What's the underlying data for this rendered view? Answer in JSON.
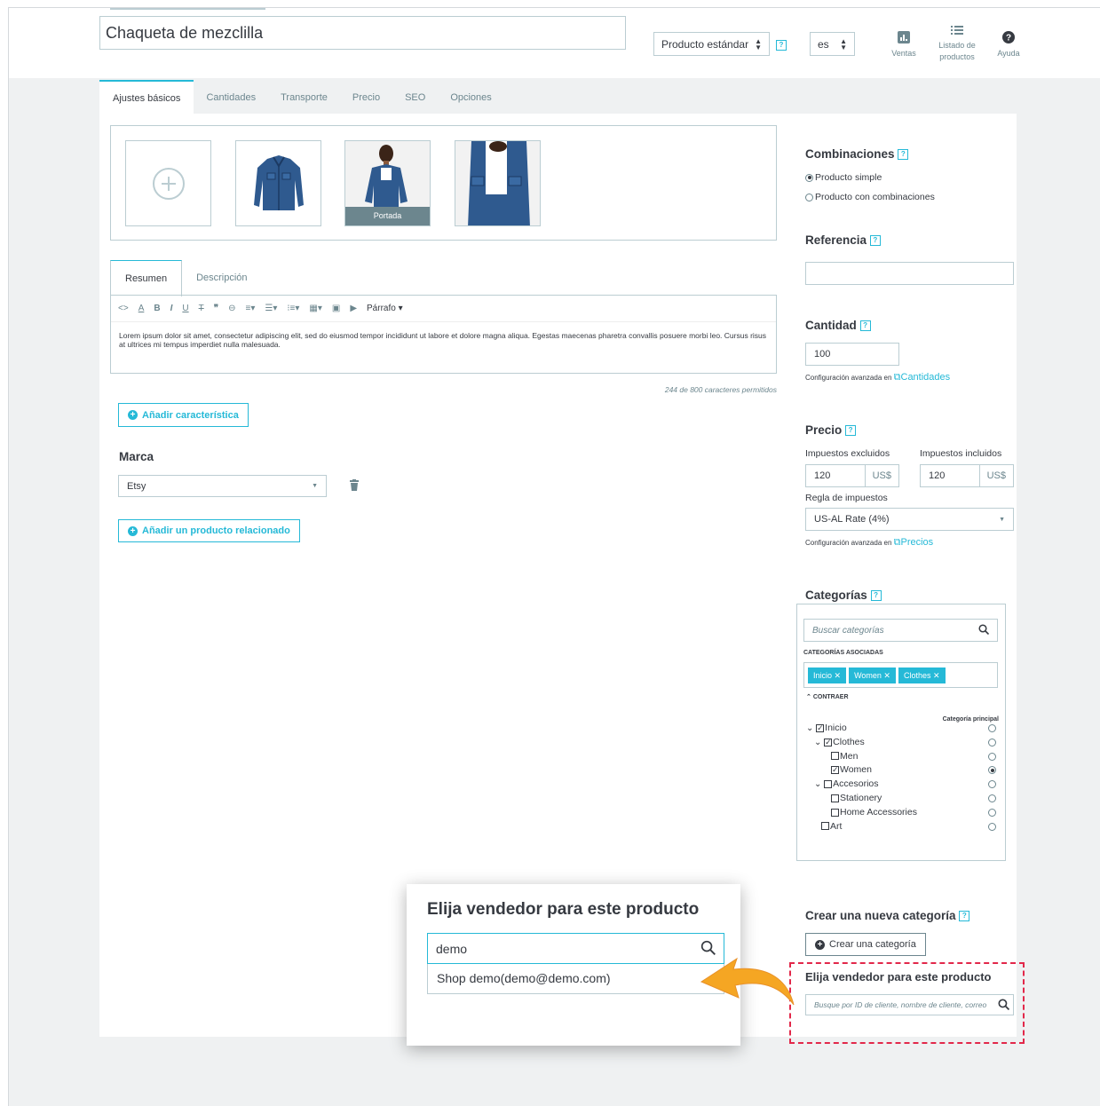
{
  "header": {
    "product_name": "Chaqueta de mezclilla",
    "product_type": "Producto estándar",
    "language": "es",
    "help_mark": "?",
    "sales_label": "Ventas",
    "product_list_label_1": "Listado de",
    "product_list_label_2": "productos",
    "help_label": "Ayuda"
  },
  "tabs": [
    "Ajustes básicos",
    "Cantidades",
    "Transporte",
    "Precio",
    "SEO",
    "Opciones"
  ],
  "images": {
    "cover_label": "Portada"
  },
  "description": {
    "tabs": [
      "Resumen",
      "Descripción"
    ],
    "paragraph_label": "Párrafo",
    "text": "Lorem ipsum dolor sit amet, consectetur adipiscing elit, sed do eiusmod tempor incididunt ut labore et dolore magna aliqua. Egestas maecenas pharetra convallis posuere morbi leo. Cursus risus at ultrices mi tempus imperdiet nulla malesuada.",
    "char_count": "244 de 800 caracteres permitidos"
  },
  "feature_button": "Añadir característica",
  "brand": {
    "label": "Marca",
    "value": "Etsy"
  },
  "related_button": "Añadir un producto relacionado",
  "combinations": {
    "title": "Combinaciones",
    "simple": "Producto simple",
    "with_combinations": "Producto con combinaciones"
  },
  "reference": {
    "title": "Referencia",
    "value": ""
  },
  "quantity": {
    "title": "Cantidad",
    "value": "100",
    "advanced_prefix": "Configuración avanzada en",
    "advanced_link": "Cantidades"
  },
  "price": {
    "title": "Precio",
    "tax_excl_label": "Impuestos excluidos",
    "tax_incl_label": "Impuestos incluidos",
    "tax_excl_value": "120",
    "tax_incl_value": "120",
    "currency": "US$",
    "tax_rule_label": "Regla de impuestos",
    "tax_rule_value": "US-AL Rate (4%)",
    "advanced_prefix": "Configuración avanzada en",
    "advanced_link": "Precios"
  },
  "categories": {
    "title": "Categorías",
    "search_placeholder": "Buscar categorías",
    "associated_label": "CATEGORÍAS ASOCIADAS",
    "tags": [
      "Inicio",
      "Women",
      "Clothes"
    ],
    "collapse_label": "CONTRAER",
    "main_category_label": "Categoría principal",
    "tree": [
      {
        "label": "Inicio",
        "checked": true,
        "main": false
      },
      {
        "label": "Clothes",
        "checked": true,
        "main": false
      },
      {
        "label": "Men",
        "checked": false,
        "main": false
      },
      {
        "label": "Women",
        "checked": true,
        "main": true
      },
      {
        "label": "Accesorios",
        "checked": false,
        "main": false
      },
      {
        "label": "Stationery",
        "checked": false,
        "main": false
      },
      {
        "label": "Home Accessories",
        "checked": false,
        "main": false
      },
      {
        "label": "Art",
        "checked": false,
        "main": false
      }
    ]
  },
  "new_category": {
    "title": "Crear una nueva categoría",
    "button": "Crear una categoría"
  },
  "vendor": {
    "title": "Elija vendedor para este producto",
    "placeholder": "Busque por ID de cliente, nombre de cliente, correo"
  },
  "popup": {
    "title": "Elija vendedor para este producto",
    "search_value": "demo",
    "result": "Shop demo(demo@demo.com)"
  },
  "colors": {
    "accent": "#25b9d7",
    "highlight": "#e2284a",
    "arrow": "#f5a623"
  }
}
